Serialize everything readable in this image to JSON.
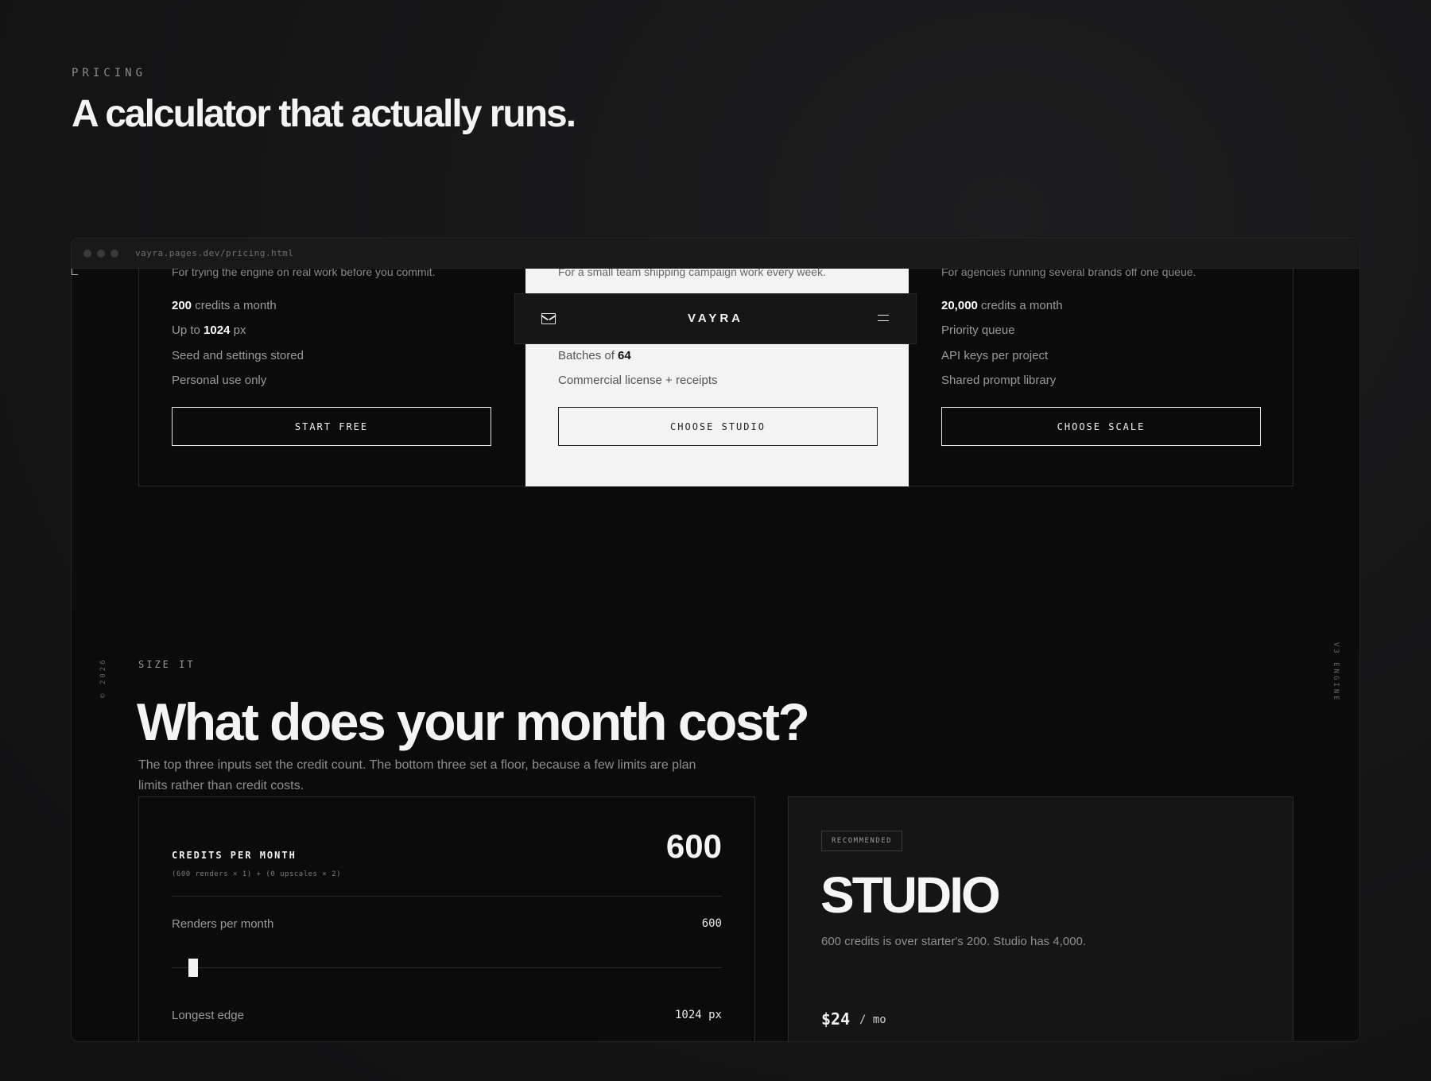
{
  "header": {
    "eyebrow": "PRICING",
    "title": "A calculator that actually runs."
  },
  "browser": {
    "url": "vayra.pages.dev/pricing.html"
  },
  "side": {
    "left": "© 2026",
    "right": "V3 ENGINE"
  },
  "nav": {
    "brand": "VAYRA",
    "mail_icon": "mail-icon",
    "menu_icon": "menu-icon"
  },
  "plans": [
    {
      "desc": "For trying the engine on real work before you commit.",
      "f1_bold": "200",
      "f1_rest": " credits a month",
      "f2_pre": "Up to ",
      "f2_bold": "1024",
      "f2_rest": " px",
      "f3": "Seed and settings stored",
      "f4": "Personal use only",
      "button": "START FREE"
    },
    {
      "desc": "For a small team shipping campaign work every week.",
      "f3_pre": "Batches of ",
      "f3_bold": "64",
      "f4": "Commercial license + receipts",
      "button": "CHOOSE STUDIO"
    },
    {
      "desc": "For agencies running several brands off one queue.",
      "f1_bold": "20,000",
      "f1_rest": " credits a month",
      "f2": "Priority queue",
      "f3": "API keys per project",
      "f4": "Shared prompt library",
      "button": "CHOOSE SCALE"
    }
  ],
  "calculator": {
    "eyebrow": "SIZE IT",
    "title": "What does your month cost?",
    "subtitle": "The top three inputs set the credit count. The bottom three set a floor, because a few limits are plan limits rather than credit costs.",
    "credits_label": "CREDITS PER MONTH",
    "credits_formula": "(600 renders × 1) + (0 upscales × 2)",
    "credits_value": "600",
    "renders_label": "Renders per month",
    "renders_value": "600",
    "renders_slider_level": 0.03,
    "edge_label": "Longest edge",
    "edge_value": "1024 px"
  },
  "recommendation": {
    "badge": "RECOMMENDED",
    "plan": "STUDIO",
    "note": "600 credits is over starter's 200. Studio has 4,000.",
    "price": "$24",
    "period": "/ mo"
  }
}
